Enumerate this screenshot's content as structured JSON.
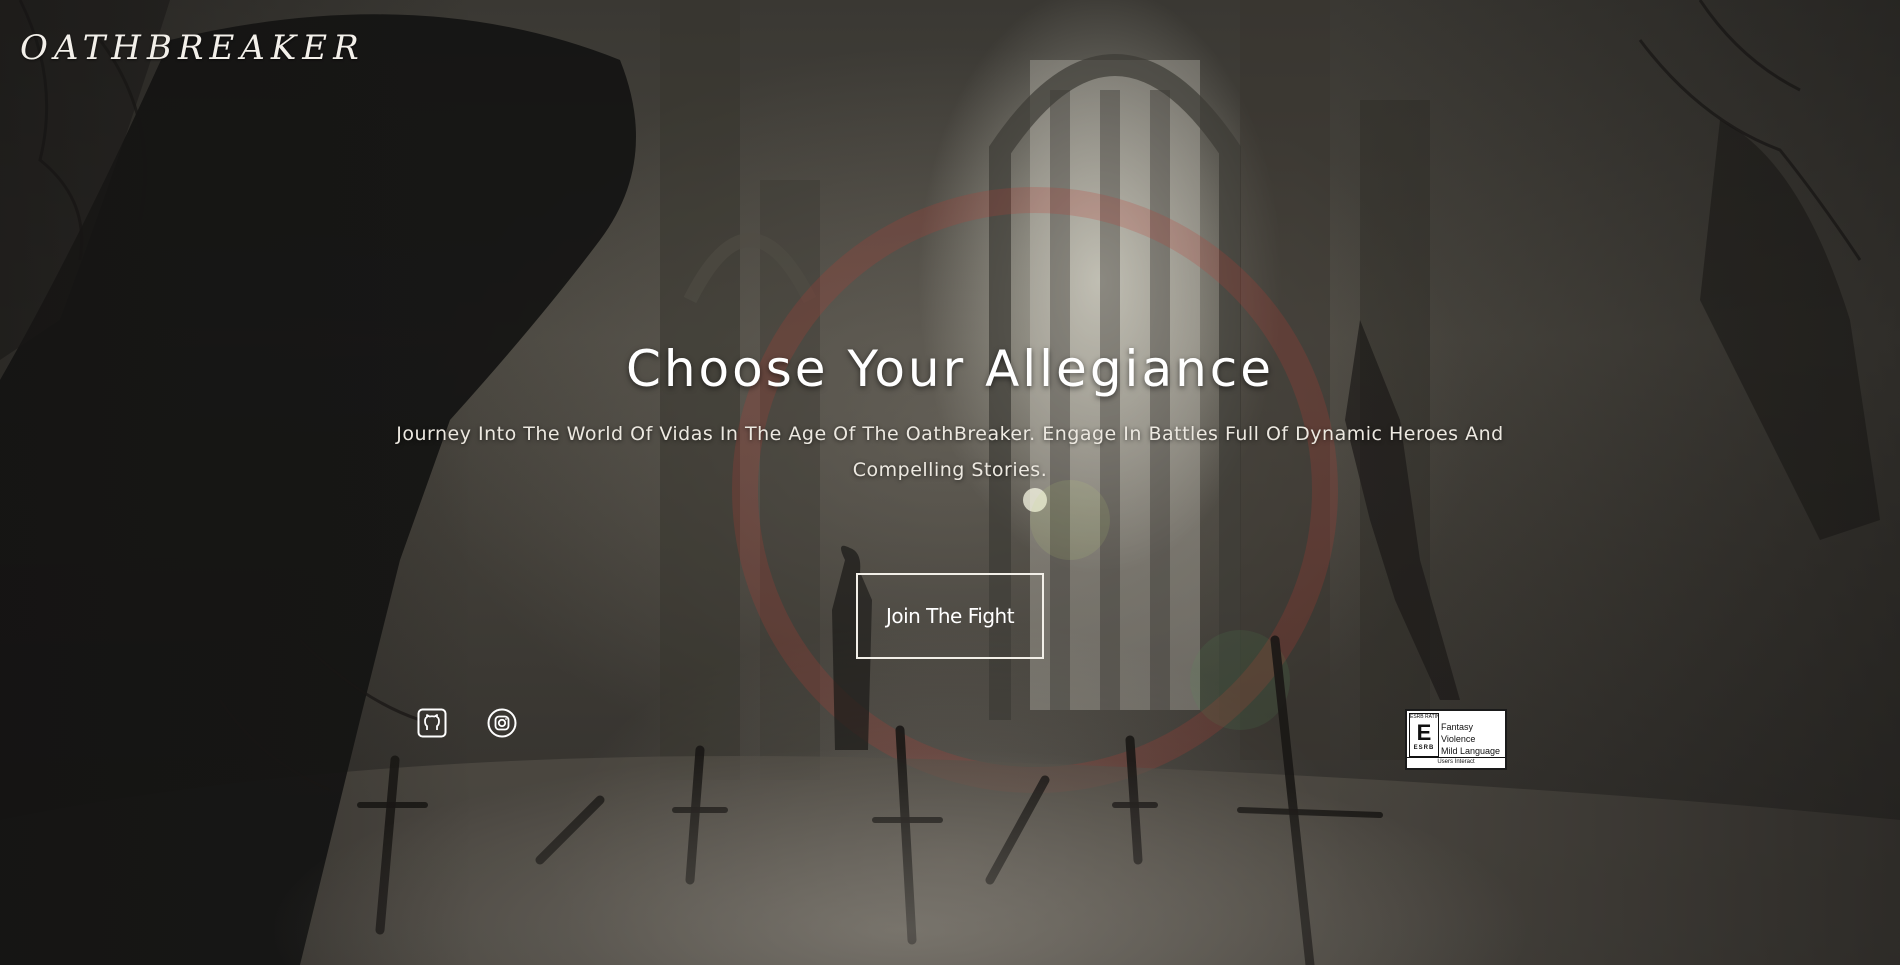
{
  "header": {
    "logo_text": "OATHBREAKER"
  },
  "hero": {
    "headline": "Choose Your Allegiance",
    "subtitle": "Journey Into The World Of Vidas In The Age Of The OathBreaker. Engage In Battles Full Of Dynamic Heroes And Compelling Stories.",
    "cta_label": "Join The Fight"
  },
  "social": {
    "items": [
      {
        "icon": "github-icon"
      },
      {
        "icon": "instagram-icon"
      }
    ]
  },
  "rating": {
    "board_top": "ESRB RATING",
    "letter": "E",
    "board_brand": "ESRB",
    "descriptors": [
      "Fantasy Violence",
      "Mild Language"
    ],
    "footer": "Users Interact"
  },
  "colors": {
    "text": "#ffffff",
    "button_border": "#f2efe8",
    "background": "#3f3c36"
  }
}
